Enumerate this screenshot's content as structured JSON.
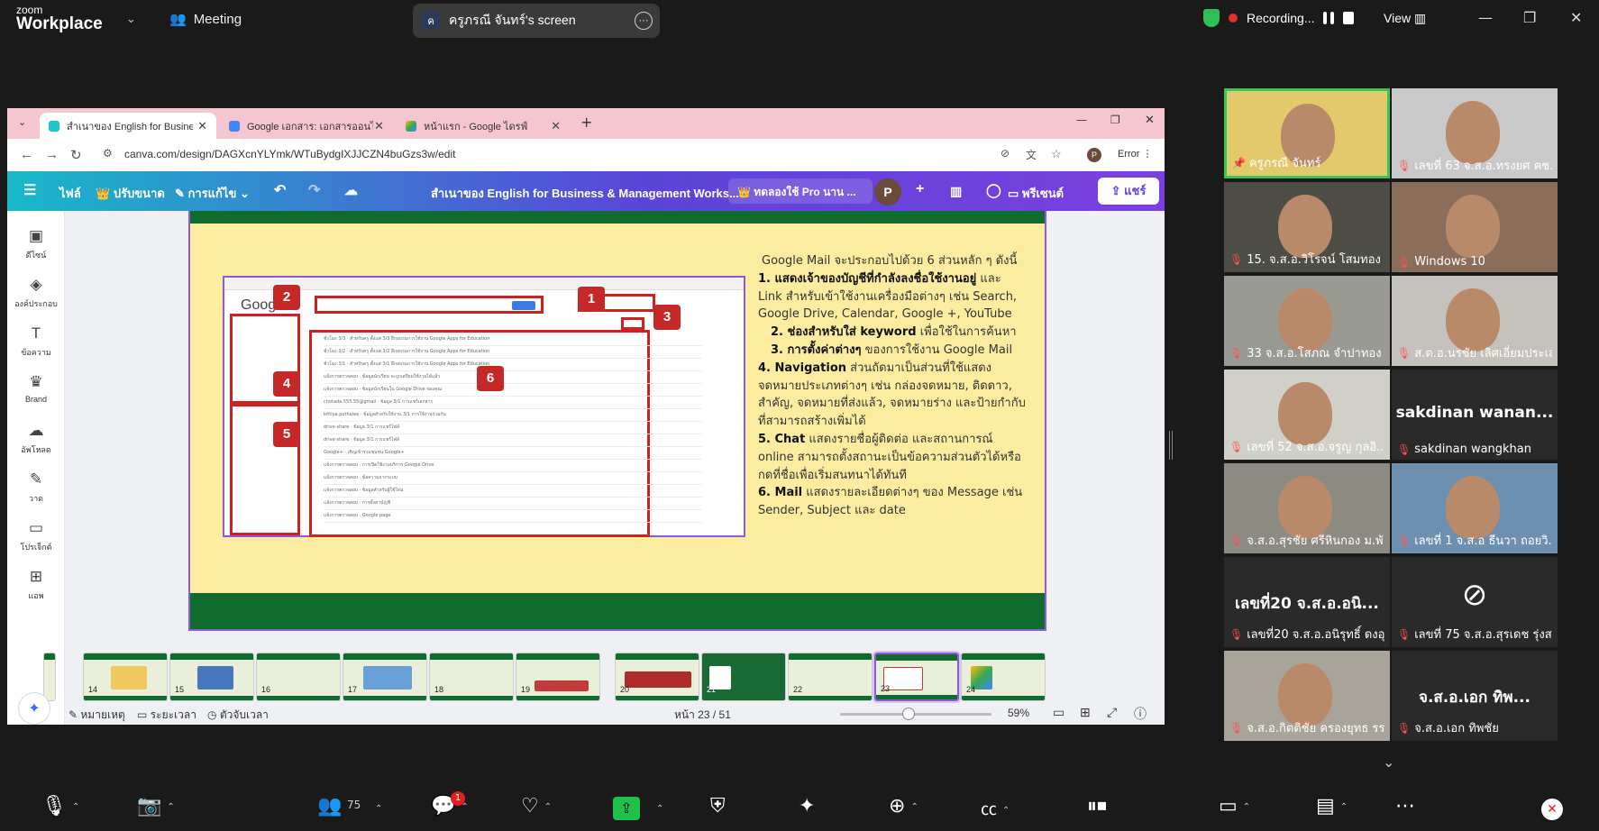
{
  "topbar": {
    "brand_small": "zoom",
    "brand_main": "Workplace",
    "meeting_label": "Meeting",
    "screen_owner_initial": "ค",
    "screen_title": "ครูภรณี  จันทร์'s screen",
    "recording_label": "Recording...",
    "view_label": "View"
  },
  "browser": {
    "tabs": [
      {
        "label": "สำเนาของ English for Business &",
        "active": true
      },
      {
        "label": "Google เอกสาร: เอกสารออนไลน์และ",
        "active": false
      },
      {
        "label": "หน้าแรก - Google ไดรฟ์",
        "active": false
      }
    ],
    "url": "canva.com/design/DAGXcnYLYmk/WTuBydgIXJJCZN4buGzs3w/edit",
    "error_label": "Error",
    "profile_initial": "P"
  },
  "canva_toolbar": {
    "file": "ไฟล์",
    "resize": "ปรับขนาด",
    "edit": "การแก้ไข",
    "doc_title": "สำเนาของ English for Business & Management Works...",
    "trial": "ทดลองใช้ Pro นาน ...",
    "avatar": "P",
    "present": "พรีเซนต์",
    "share": "แชร์"
  },
  "left_rail": [
    {
      "label": "ดีไซน์",
      "icon": "layout-icon"
    },
    {
      "label": "องค์ประกอบ",
      "icon": "shapes-icon"
    },
    {
      "label": "ข้อความ",
      "icon": "text-icon"
    },
    {
      "label": "Brand",
      "icon": "brand-icon"
    },
    {
      "label": "อัพโหลด",
      "icon": "upload-icon"
    },
    {
      "label": "วาด",
      "icon": "draw-icon"
    },
    {
      "label": "โปรเจ็กต์",
      "icon": "folder-icon"
    },
    {
      "label": "แอพ",
      "icon": "apps-icon"
    }
  ],
  "slide": {
    "gmail_logo": "Google",
    "badges": [
      "1",
      "2",
      "3",
      "4",
      "5",
      "6"
    ],
    "intro": "Google Mail จะประกอบไปด้วย 6 ส่วนหลัก ๆ ดังนี้",
    "p1_bold": "1. แสดงเจ้าของบัญชีที่กำลังลงชื่อใช้งานอยู่",
    "p1_rest": " และ Link สำหรับเข้าใช้งานเครื่องมือต่างๆ เช่น Search, Google Drive, Calendar, Google +, YouTube",
    "p2_bold": "2. ช่องสำหรับใส่ keyword",
    "p2_rest": " เพื่อใช้ในการค้นหา",
    "p3_bold": "3. การตั้งค่าต่างๆ",
    "p3_rest": " ของการใช้งาน Google Mail",
    "p4_bold": "4. Navigation",
    "p4_rest": " ส่วนถัดมาเป็นส่วนที่ใช้แสดงจดหมายประเภทต่างๆ เช่น กล่องจดหมาย, ติดดาว, สำคัญ, จดหมายที่ส่งแล้ว, จดหมายร่าง และป้ายกำกับที่สามารถสร้างเพิ่มได้",
    "p5_bold": "5. Chat",
    "p5_rest": " แสดงรายชื่อผู้ติดต่อ และสถานการณ์ online สามารถตั้งสถานะเป็นข้อความส่วนตัวได้หรือกดที่ชื่อเพื่อเริ่มสนทนาได้ทันที",
    "p6_bold": "6. Mail",
    "p6_rest": "  แสดงรายละเอียดต่างๆ ของ Message เช่น Sender, Subject และ date"
  },
  "thumbnails": [
    "14",
    "15",
    "16",
    "17",
    "18",
    "19",
    "20",
    "21",
    "22",
    "23",
    "24"
  ],
  "selected_thumbnail": "23",
  "footer": {
    "notes": "หมายเหตุ",
    "duration": "ระยะเวลา",
    "timer": "ตัวจับเวลา",
    "page": "หน้า 23 / 51",
    "zoom_fraction": 0.45,
    "zoom": "59%"
  },
  "participants": [
    {
      "name": "ครูภรณี  จันทร์",
      "active": true,
      "video": true
    },
    {
      "name": "เลขที่ 63 จ.ส.อ.ทรงยศ คช...",
      "video": true
    },
    {
      "name": "15. จ.ส.อ.วิโรจน์  โสมทอง ...",
      "video": true
    },
    {
      "name": "Windows 10",
      "video": true
    },
    {
      "name": "33 จ.ส.อ.โสภณ จำปาทอง ...",
      "video": true
    },
    {
      "name": "ส.ต.อ.นรชัย เลิศเอี่ยมประเส...",
      "video": true
    },
    {
      "name": "เลขที่ 52 จ.ส.อ.จรูญ  กุลอิ...",
      "video": true
    },
    {
      "name": "sakdinan wangkhan",
      "big": "sakdinan  wanan...",
      "video": false
    },
    {
      "name": "จ.ส.อ.สุรชัย ศรีหินกอง ม.พั...",
      "video": true
    },
    {
      "name": "เลขที่ 1 จ.ส.อ ธีนวา ถอยวิ...",
      "video": true
    },
    {
      "name": "เลขที่20 จ.ส.อ.อนิรุทธิ์ ดงอุ...",
      "big": "เลขที่20  จ.ส.อ.อนิ...",
      "video": false
    },
    {
      "name": "เลขที่ 75 จ.ส.อ.สุรเดช รุ่งส...",
      "video": false,
      "camoff": true
    },
    {
      "name": "จ.ส.อ.กิตติชัย ครองยุทธ รร...",
      "video": true
    },
    {
      "name": "จ.ส.อ.เอก    ทิพชัย",
      "big": "จ.ส.อ.เอก       ทิพ...",
      "video": false
    }
  ],
  "bottombar": {
    "participant_count": "75",
    "chat_notifications": "1"
  }
}
